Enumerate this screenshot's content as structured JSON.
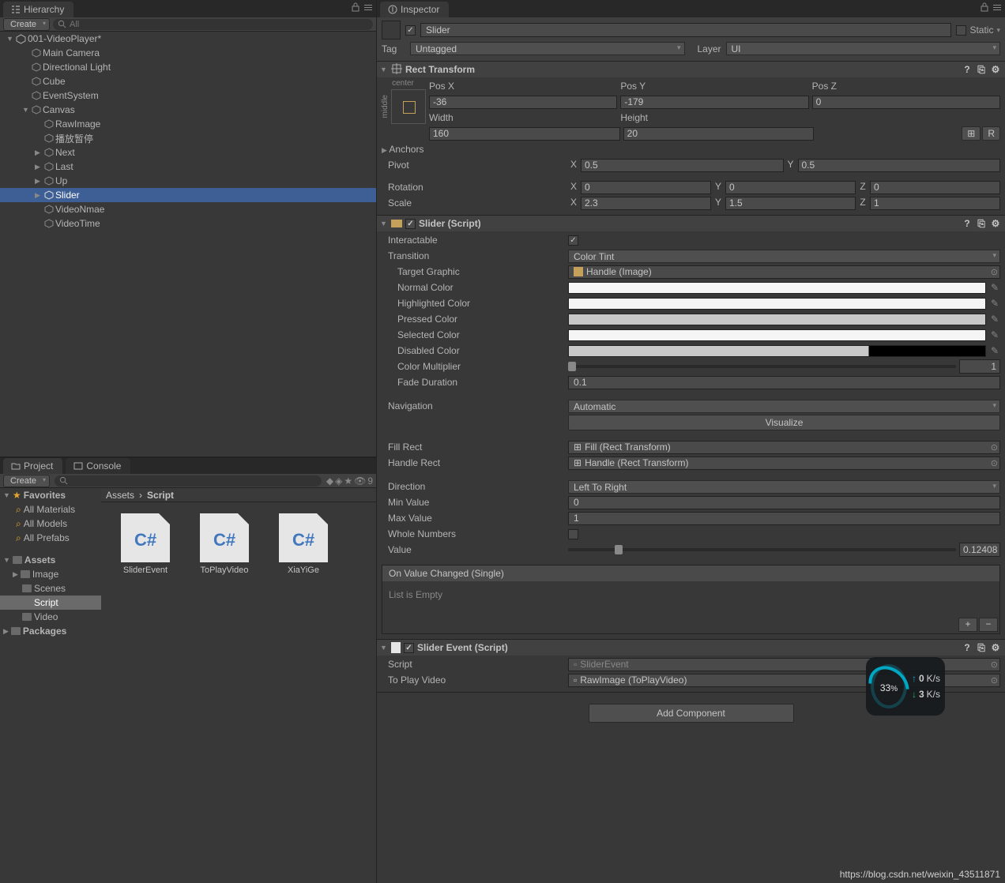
{
  "hierarchy": {
    "tab": "Hierarchy",
    "create_label": "Create",
    "search_placeholder": "All",
    "scene": "001-VideoPlayer*",
    "items": {
      "main_camera": "Main Camera",
      "directional_light": "Directional Light",
      "cube": "Cube",
      "event_system": "EventSystem",
      "canvas": "Canvas",
      "raw_image": "RawImage",
      "play_pause": "播放暂停",
      "next": "Next",
      "last": "Last",
      "up": "Up",
      "slider": "Slider",
      "video_name": "VideoNmae",
      "video_time": "VideoTime"
    }
  },
  "project": {
    "tab_project": "Project",
    "tab_console": "Console",
    "create_label": "Create",
    "hidden_count": "9",
    "favorites": {
      "label": "Favorites",
      "all_materials": "All Materials",
      "all_models": "All Models",
      "all_prefabs": "All Prefabs"
    },
    "assets": {
      "label": "Assets",
      "image": "Image",
      "scenes": "Scenes",
      "script": "Script",
      "video": "Video"
    },
    "packages": "Packages",
    "breadcrumb_root": "Assets",
    "breadcrumb_current": "Script",
    "files": [
      {
        "name": "SliderEvent"
      },
      {
        "name": "ToPlayVideo"
      },
      {
        "name": "XiaYiGe"
      }
    ]
  },
  "inspector": {
    "tab": "Inspector",
    "go_name": "Slider",
    "static_label": "Static",
    "tag_label": "Tag",
    "tag_value": "Untagged",
    "layer_label": "Layer",
    "layer_value": "UI"
  },
  "rect_transform": {
    "title": "Rect Transform",
    "center": "center",
    "middle": "middle",
    "pos_x_label": "Pos X",
    "pos_x": "-36",
    "pos_y_label": "Pos Y",
    "pos_y": "-179",
    "pos_z_label": "Pos Z",
    "pos_z": "0",
    "width_label": "Width",
    "width": "160",
    "height_label": "Height",
    "height": "20",
    "anchors_label": "Anchors",
    "pivot_label": "Pivot",
    "pivot_x": "0.5",
    "pivot_y": "0.5",
    "rotation_label": "Rotation",
    "rot_x": "0",
    "rot_y": "0",
    "rot_z": "0",
    "scale_label": "Scale",
    "scale_x": "2.3",
    "scale_y": "1.5",
    "scale_z": "1",
    "x": "X",
    "y": "Y",
    "z": "Z"
  },
  "slider": {
    "title": "Slider (Script)",
    "interactable_label": "Interactable",
    "transition_label": "Transition",
    "transition_value": "Color Tint",
    "target_graphic_label": "Target Graphic",
    "target_graphic_value": "Handle (Image)",
    "normal_label": "Normal Color",
    "highlighted_label": "Highlighted Color",
    "pressed_label": "Pressed Color",
    "selected_label": "Selected Color",
    "disabled_label": "Disabled Color",
    "color_multiplier_label": "Color Multiplier",
    "color_multiplier_value": "1",
    "fade_duration_label": "Fade Duration",
    "fade_duration_value": "0.1",
    "navigation_label": "Navigation",
    "navigation_value": "Automatic",
    "visualize": "Visualize",
    "fill_rect_label": "Fill Rect",
    "fill_rect_value": "Fill (Rect Transform)",
    "handle_rect_label": "Handle Rect",
    "handle_rect_value": "Handle (Rect Transform)",
    "direction_label": "Direction",
    "direction_value": "Left To Right",
    "min_value_label": "Min Value",
    "min_value": "0",
    "max_value_label": "Max Value",
    "max_value": "1",
    "whole_numbers_label": "Whole Numbers",
    "value_label": "Value",
    "value": "0.12408",
    "on_value_changed": "On Value Changed (Single)",
    "list_empty": "List is Empty"
  },
  "slider_event": {
    "title": "Slider Event (Script)",
    "script_label": "Script",
    "script_value": "SliderEvent",
    "to_play_video_label": "To Play Video",
    "to_play_video_value": "RawImage (ToPlayVideo)"
  },
  "add_component": "Add Component",
  "overlay": {
    "pct": "33",
    "pct_unit": "%",
    "up": "0",
    "down": "3",
    "unit": "K/s"
  },
  "watermark": "https://blog.csdn.net/weixin_43511871"
}
